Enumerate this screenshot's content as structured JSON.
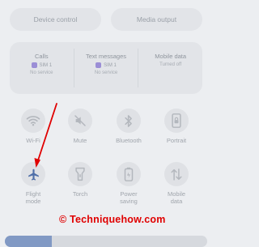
{
  "top_buttons": {
    "device_control": "Device control",
    "media_output": "Media output"
  },
  "sim_card": {
    "calls": {
      "title": "Calls",
      "sim": "SIM 1",
      "status": "No service"
    },
    "text_messages": {
      "title": "Text messages",
      "sim": "SIM 1",
      "status": "No service"
    },
    "mobile_data": {
      "title": "Mobile data",
      "status": "Turned off"
    }
  },
  "tiles": {
    "wifi": "Wi-Fi",
    "mute": "Mute",
    "bluetooth": "Bluetooth",
    "portrait": "Portrait",
    "flight_mode": "Flight\nmode",
    "torch": "Torch",
    "power_saving": "Power\nsaving",
    "mobile_data": "Mobile\ndata"
  },
  "watermark": "© Techniquehow.com",
  "brightness": {
    "level": 0.23
  },
  "colors": {
    "accent": "#8199c4",
    "arrow": "#e00000",
    "flight_icon": "#4f6fa8"
  },
  "icons": {
    "wifi": "wifi-icon",
    "mute": "mute-icon",
    "bluetooth": "bluetooth-icon",
    "portrait": "portrait-lock-icon",
    "flight_mode": "airplane-icon",
    "torch": "flashlight-icon",
    "power_saving": "battery-saver-icon",
    "mobile_data": "data-arrows-icon"
  }
}
